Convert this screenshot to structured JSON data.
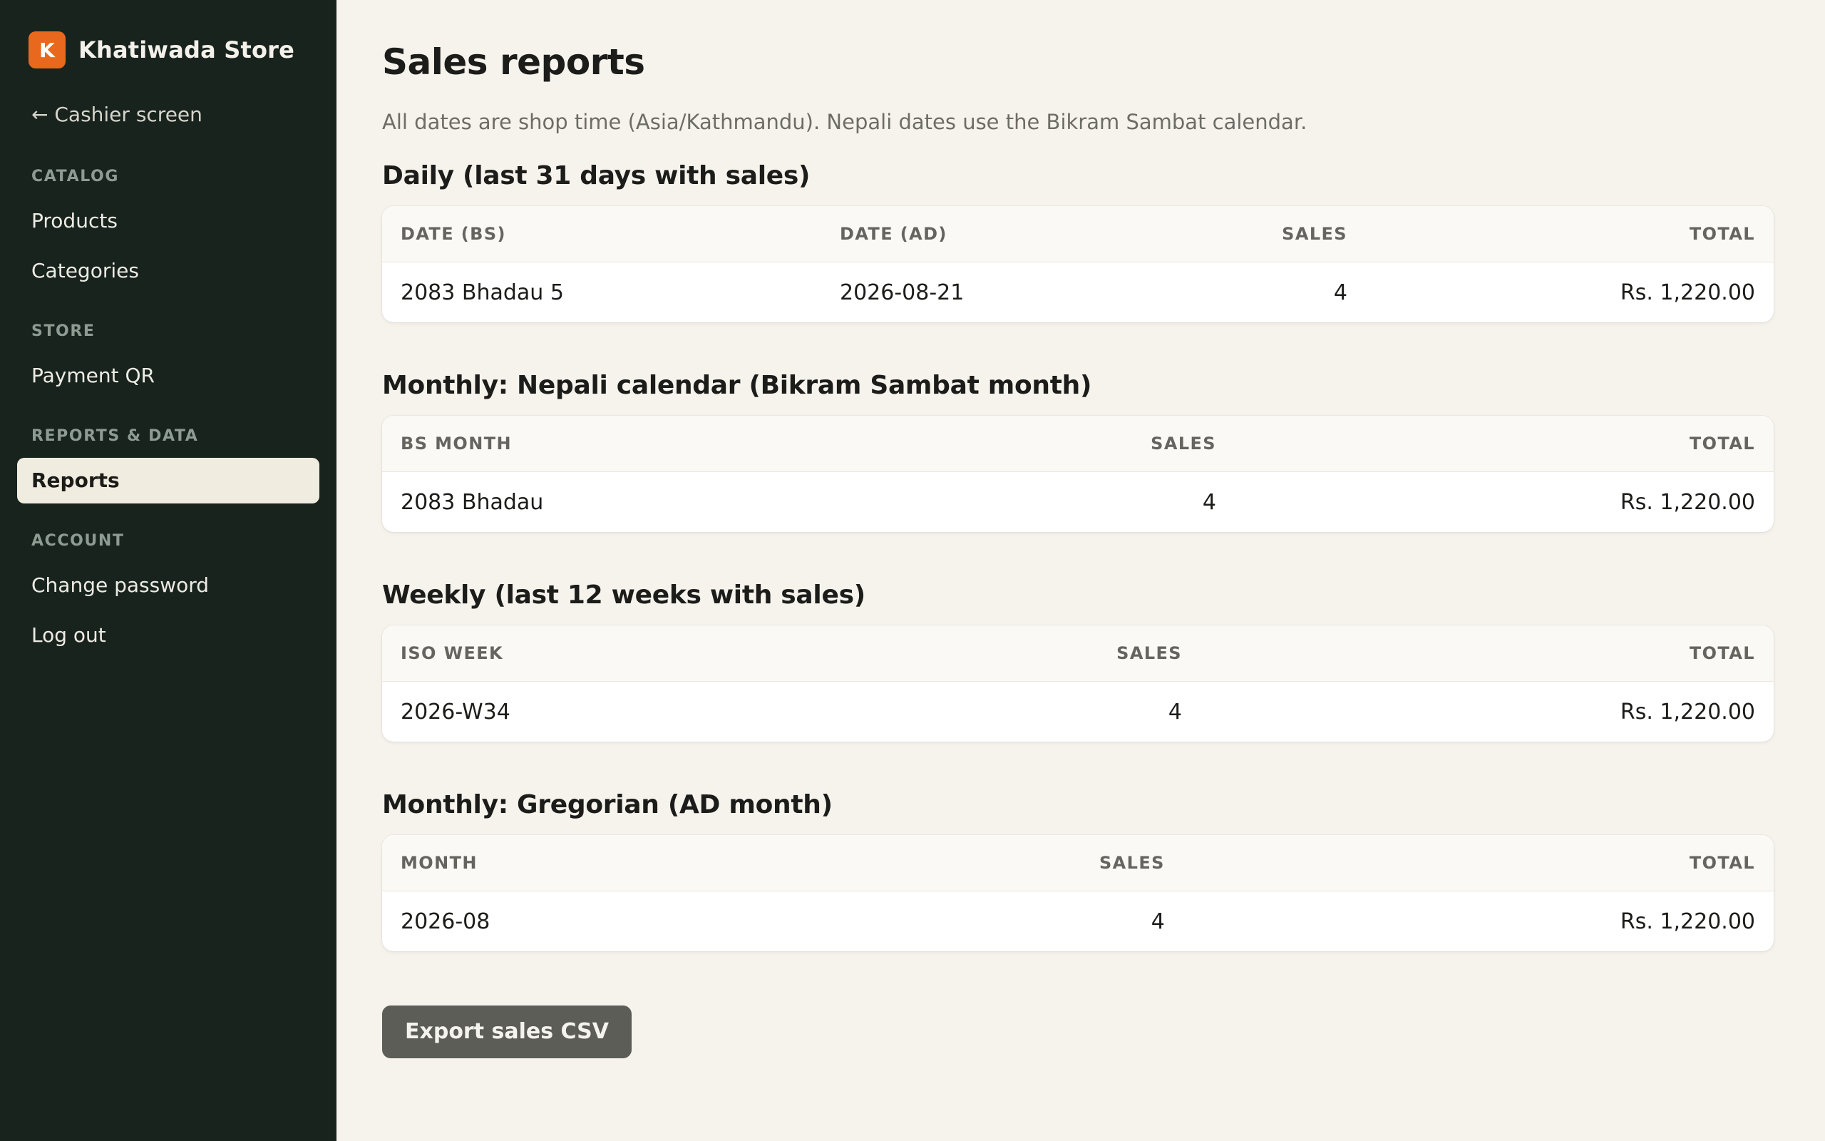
{
  "brand": {
    "initial": "K",
    "name": "Khatiwada Store",
    "accent_color": "#e8691d"
  },
  "sidebar": {
    "back_link": "← Cashier screen",
    "sections": [
      {
        "title": "CATALOG",
        "items": [
          "Products",
          "Categories"
        ]
      },
      {
        "title": "STORE",
        "items": [
          "Payment QR"
        ]
      },
      {
        "title": "REPORTS & DATA",
        "items": [
          "Reports"
        ]
      },
      {
        "title": "ACCOUNT",
        "items": [
          "Change password",
          "Log out"
        ]
      }
    ],
    "active_item": "Reports"
  },
  "page": {
    "title": "Sales reports",
    "subtitle": "All dates are shop time (Asia/Kathmandu). Nepali dates use the Bikram Sambat calendar."
  },
  "daily": {
    "title": "Daily (last 31 days with sales)",
    "headers": [
      "DATE (BS)",
      "DATE (AD)",
      "SALES",
      "TOTAL"
    ],
    "rows": [
      [
        "2083 Bhadau 5",
        "2026-08-21",
        "4",
        "Rs. 1,220.00"
      ]
    ]
  },
  "monthly_bs": {
    "title": "Monthly: Nepali calendar (Bikram Sambat month)",
    "headers": [
      "BS MONTH",
      "SALES",
      "TOTAL"
    ],
    "rows": [
      [
        "2083 Bhadau",
        "4",
        "Rs. 1,220.00"
      ]
    ]
  },
  "weekly": {
    "title": "Weekly (last 12 weeks with sales)",
    "headers": [
      "ISO WEEK",
      "SALES",
      "TOTAL"
    ],
    "rows": [
      [
        "2026-W34",
        "4",
        "Rs. 1,220.00"
      ]
    ]
  },
  "monthly_ad": {
    "title": "Monthly: Gregorian (AD month)",
    "headers": [
      "MONTH",
      "SALES",
      "TOTAL"
    ],
    "rows": [
      [
        "2026-08",
        "4",
        "Rs. 1,220.00"
      ]
    ]
  },
  "export_button": "Export sales CSV"
}
